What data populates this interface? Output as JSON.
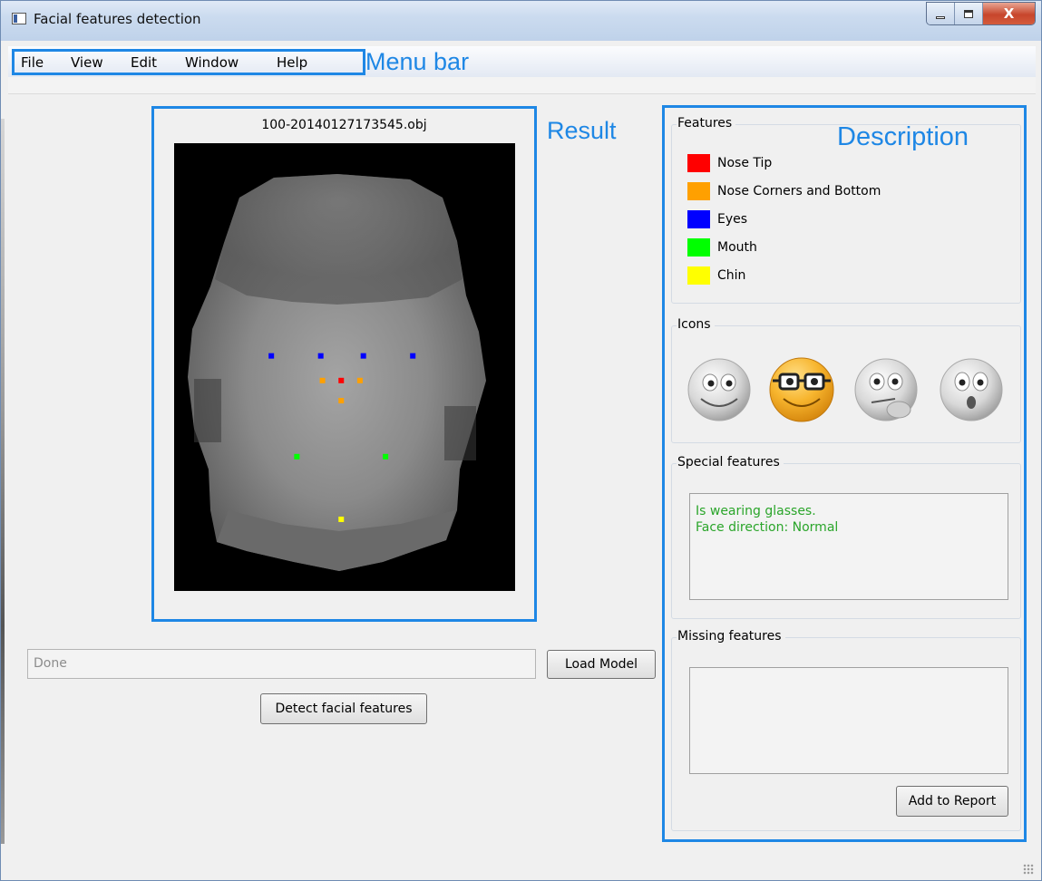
{
  "window": {
    "title": "Facial features detection",
    "close_glyph": "X"
  },
  "menu": {
    "items": [
      "File",
      "View",
      "Edit",
      "Window",
      "Help"
    ]
  },
  "annotations": {
    "menu_bar": "Menu bar",
    "result": "Result",
    "description": "Description",
    "highlight_color": "#1e87e5"
  },
  "result": {
    "filename": "100-20140127173545.obj",
    "landmarks": {
      "nose_tip": [
        [
          0.49,
          0.53
        ]
      ],
      "nose_corners_bottom": [
        [
          0.435,
          0.53
        ],
        [
          0.545,
          0.53
        ],
        [
          0.49,
          0.575
        ]
      ],
      "eyes": [
        [
          0.285,
          0.475
        ],
        [
          0.43,
          0.475
        ],
        [
          0.555,
          0.475
        ],
        [
          0.7,
          0.475
        ]
      ],
      "mouth": [
        [
          0.36,
          0.7
        ],
        [
          0.62,
          0.7
        ]
      ],
      "chin": [
        [
          0.49,
          0.84
        ]
      ]
    }
  },
  "features": {
    "title": "Features",
    "legend": [
      {
        "label": "Nose Tip",
        "color": "#ff0000"
      },
      {
        "label": "Nose Corners and Bottom",
        "color": "#ffa000"
      },
      {
        "label": "Eyes",
        "color": "#0000ff"
      },
      {
        "label": "Mouth",
        "color": "#00ff00"
      },
      {
        "label": "Chin",
        "color": "#ffff00"
      }
    ]
  },
  "icons": {
    "title": "Icons",
    "items": [
      "neutral-face-icon",
      "glasses-face-icon",
      "thinking-face-icon",
      "surprised-face-icon"
    ],
    "active": "glasses-face-icon"
  },
  "special": {
    "title": "Special features",
    "lines": [
      "Is wearing glasses.",
      "Face direction: Normal"
    ],
    "text_color": "#2aa52a"
  },
  "missing": {
    "title": "Missing features",
    "value": ""
  },
  "controls": {
    "status": "Done",
    "load_model": "Load Model",
    "detect": "Detect facial features",
    "add_report": "Add to Report"
  }
}
